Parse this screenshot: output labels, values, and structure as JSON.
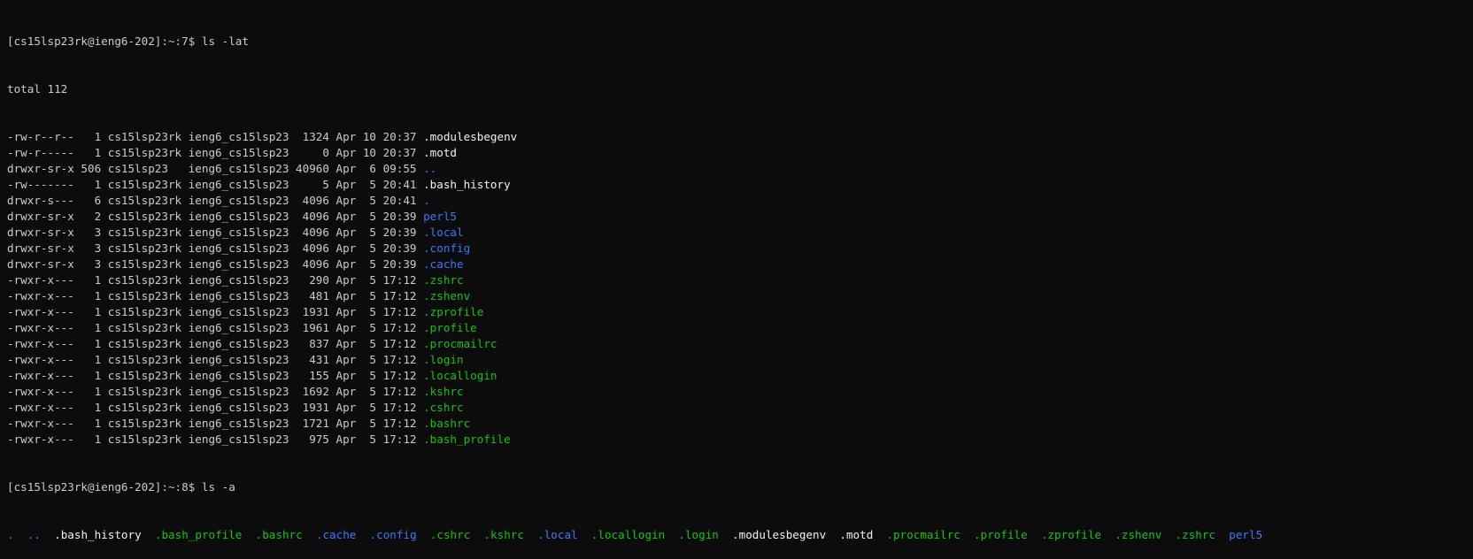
{
  "colors": {
    "background": "#0c0c0c",
    "text": "#cccccc",
    "directory": "#3b78ff",
    "executable": "#16c60c",
    "regular": "#f2f2f2"
  },
  "prompt1": {
    "prompt": "[cs15lsp23rk@ieng6-202]:~:7$ ",
    "command": "ls -lat"
  },
  "total": "total 112",
  "rows": [
    {
      "meta": "-rw-r--r--   1 cs15lsp23rk ieng6_cs15lsp23  1324 Apr 10 20:37 ",
      "name": ".modulesbegenv",
      "color": "regular"
    },
    {
      "meta": "-rw-r-----   1 cs15lsp23rk ieng6_cs15lsp23     0 Apr 10 20:37 ",
      "name": ".motd",
      "color": "regular"
    },
    {
      "meta": "drwxr-sr-x 506 cs15lsp23   ieng6_cs15lsp23 40960 Apr  6 09:55 ",
      "name": "..",
      "color": "directory"
    },
    {
      "meta": "-rw-------   1 cs15lsp23rk ieng6_cs15lsp23     5 Apr  5 20:41 ",
      "name": ".bash_history",
      "color": "regular"
    },
    {
      "meta": "drwxr-s---   6 cs15lsp23rk ieng6_cs15lsp23  4096 Apr  5 20:41 ",
      "name": ".",
      "color": "directory"
    },
    {
      "meta": "drwxr-sr-x   2 cs15lsp23rk ieng6_cs15lsp23  4096 Apr  5 20:39 ",
      "name": "perl5",
      "color": "directory"
    },
    {
      "meta": "drwxr-sr-x   3 cs15lsp23rk ieng6_cs15lsp23  4096 Apr  5 20:39 ",
      "name": ".local",
      "color": "directory"
    },
    {
      "meta": "drwxr-sr-x   3 cs15lsp23rk ieng6_cs15lsp23  4096 Apr  5 20:39 ",
      "name": ".config",
      "color": "directory"
    },
    {
      "meta": "drwxr-sr-x   3 cs15lsp23rk ieng6_cs15lsp23  4096 Apr  5 20:39 ",
      "name": ".cache",
      "color": "directory"
    },
    {
      "meta": "-rwxr-x---   1 cs15lsp23rk ieng6_cs15lsp23   290 Apr  5 17:12 ",
      "name": ".zshrc",
      "color": "executable"
    },
    {
      "meta": "-rwxr-x---   1 cs15lsp23rk ieng6_cs15lsp23   481 Apr  5 17:12 ",
      "name": ".zshenv",
      "color": "executable"
    },
    {
      "meta": "-rwxr-x---   1 cs15lsp23rk ieng6_cs15lsp23  1931 Apr  5 17:12 ",
      "name": ".zprofile",
      "color": "executable"
    },
    {
      "meta": "-rwxr-x---   1 cs15lsp23rk ieng6_cs15lsp23  1961 Apr  5 17:12 ",
      "name": ".profile",
      "color": "executable"
    },
    {
      "meta": "-rwxr-x---   1 cs15lsp23rk ieng6_cs15lsp23   837 Apr  5 17:12 ",
      "name": ".procmailrc",
      "color": "executable"
    },
    {
      "meta": "-rwxr-x---   1 cs15lsp23rk ieng6_cs15lsp23   431 Apr  5 17:12 ",
      "name": ".login",
      "color": "executable"
    },
    {
      "meta": "-rwxr-x---   1 cs15lsp23rk ieng6_cs15lsp23   155 Apr  5 17:12 ",
      "name": ".locallogin",
      "color": "executable"
    },
    {
      "meta": "-rwxr-x---   1 cs15lsp23rk ieng6_cs15lsp23  1692 Apr  5 17:12 ",
      "name": ".kshrc",
      "color": "executable"
    },
    {
      "meta": "-rwxr-x---   1 cs15lsp23rk ieng6_cs15lsp23  1931 Apr  5 17:12 ",
      "name": ".cshrc",
      "color": "executable"
    },
    {
      "meta": "-rwxr-x---   1 cs15lsp23rk ieng6_cs15lsp23  1721 Apr  5 17:12 ",
      "name": ".bashrc",
      "color": "executable"
    },
    {
      "meta": "-rwxr-x---   1 cs15lsp23rk ieng6_cs15lsp23   975 Apr  5 17:12 ",
      "name": ".bash_profile",
      "color": "executable"
    }
  ],
  "prompt2": {
    "prompt": "[cs15lsp23rk@ieng6-202]:~:8$ ",
    "command": "ls -a"
  },
  "ls_a_items": [
    {
      "name": ".",
      "color": "directory"
    },
    {
      "name": "..",
      "color": "directory"
    },
    {
      "name": ".bash_history",
      "color": "regular"
    },
    {
      "name": ".bash_profile",
      "color": "executable"
    },
    {
      "name": ".bashrc",
      "color": "executable"
    },
    {
      "name": ".cache",
      "color": "directory"
    },
    {
      "name": ".config",
      "color": "directory"
    },
    {
      "name": ".cshrc",
      "color": "executable"
    },
    {
      "name": ".kshrc",
      "color": "executable"
    },
    {
      "name": ".local",
      "color": "directory"
    },
    {
      "name": ".locallogin",
      "color": "executable"
    },
    {
      "name": ".login",
      "color": "executable"
    },
    {
      "name": ".modulesbegenv",
      "color": "regular"
    },
    {
      "name": ".motd",
      "color": "regular"
    },
    {
      "name": ".procmailrc",
      "color": "executable"
    },
    {
      "name": ".profile",
      "color": "executable"
    },
    {
      "name": ".zprofile",
      "color": "executable"
    },
    {
      "name": ".zshenv",
      "color": "executable"
    },
    {
      "name": ".zshrc",
      "color": "executable"
    },
    {
      "name": "perl5",
      "color": "directory"
    }
  ]
}
